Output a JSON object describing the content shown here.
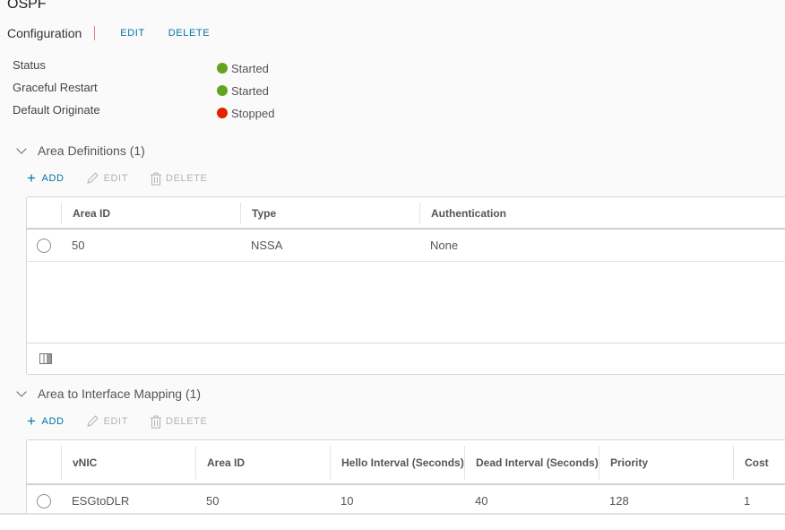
{
  "page": {
    "title": "OSPF",
    "config_label": "Configuration",
    "edit_label": "EDIT",
    "delete_label": "DELETE"
  },
  "status": [
    {
      "label": "Status",
      "value": "Started",
      "color": "#62a420"
    },
    {
      "label": "Graceful Restart",
      "value": "Started",
      "color": "#62a420"
    },
    {
      "label": "Default Originate",
      "value": "Stopped",
      "color": "#e12200"
    }
  ],
  "area_definitions": {
    "title": "Area Definitions (1)",
    "toolbar": {
      "add": "ADD",
      "edit": "EDIT",
      "delete": "DELETE"
    },
    "columns": [
      "Area ID",
      "Type",
      "Authentication"
    ],
    "rows": [
      {
        "area_id": "50",
        "type": "NSSA",
        "authentication": "None"
      }
    ],
    "footer_icon": "column-toggle-icon"
  },
  "area_interface_mapping": {
    "title": "Area to Interface Mapping (1)",
    "toolbar": {
      "add": "ADD",
      "edit": "EDIT",
      "delete": "DELETE"
    },
    "columns": [
      "vNIC",
      "Area ID",
      "Hello Interval (Seconds)",
      "Dead Interval (Seconds)",
      "Priority",
      "Cost"
    ],
    "rows": [
      {
        "vnic": "ESGtoDLR",
        "area_id": "50",
        "hello": "10",
        "dead": "40",
        "priority": "128",
        "cost": "1"
      }
    ]
  },
  "colors": {
    "accent": "#0072a3",
    "disabled": "#b3b3b3",
    "started": "#62a420",
    "stopped": "#e12200"
  }
}
